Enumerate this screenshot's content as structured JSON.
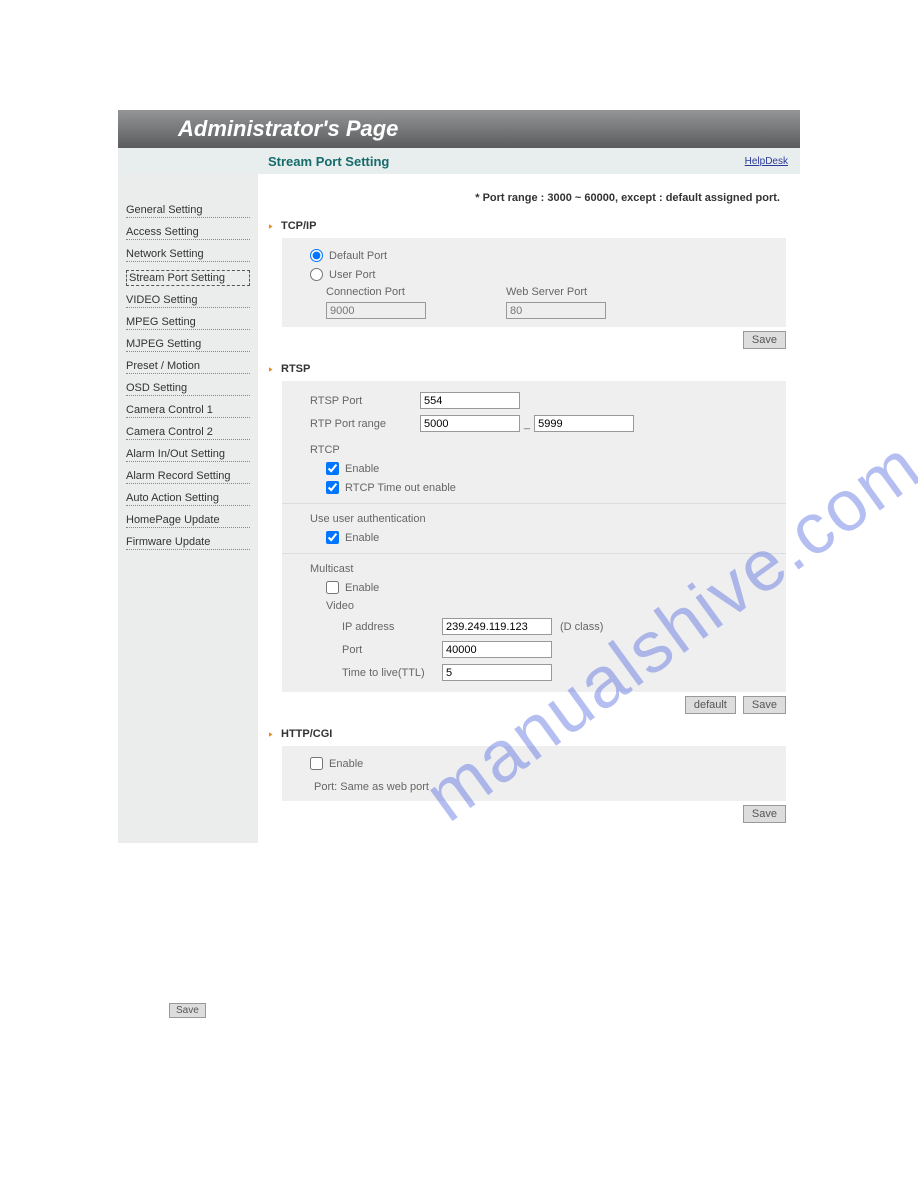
{
  "header": {
    "title": "Administrator's Page"
  },
  "subheader": {
    "title": "Stream Port Setting",
    "helpdesk": "HelpDesk"
  },
  "port_note": "* Port range : 3000 ~ 60000, except : default assigned port.",
  "sidebar": {
    "items": [
      "General Setting",
      "Access Setting",
      "Network Setting",
      "Stream Port Setting",
      "VIDEO Setting",
      "MPEG Setting",
      "MJPEG Setting",
      "Preset / Motion",
      "OSD Setting",
      "Camera Control 1",
      "Camera Control 2",
      "Alarm In/Out Setting",
      "Alarm Record Setting",
      "Auto Action Setting",
      "HomePage Update",
      "Firmware Update"
    ],
    "active_index": 3
  },
  "tcpip": {
    "title": "TCP/IP",
    "default_port_label": "Default Port",
    "user_port_label": "User Port",
    "port_mode": "default",
    "conn_port_label": "Connection Port",
    "web_port_label": "Web Server Port",
    "conn_port": "9000",
    "web_port": "80",
    "save": "Save"
  },
  "rtsp": {
    "title": "RTSP",
    "rtsp_port_label": "RTSP Port",
    "rtsp_port": "554",
    "rtp_range_label": "RTP Port range",
    "rtp_from": "5000",
    "rtp_to": "5999",
    "rtcp_label": "RTCP",
    "enable_label": "Enable",
    "rtcp_enable": true,
    "rtcp_timeout_label": "RTCP Time out enable",
    "rtcp_timeout": true,
    "auth_label": "Use user authentication",
    "auth_enable": true,
    "multicast_label": "Multicast",
    "multicast_enable": false,
    "video_label": "Video",
    "ip_label": "IP address",
    "ip": "239.249.119.123",
    "dclass": "(D class)",
    "port_label": "Port",
    "port": "40000",
    "ttl_label": "Time to live(TTL)",
    "ttl": "5",
    "default_btn": "default",
    "save": "Save"
  },
  "httpcgi": {
    "title": "HTTP/CGI",
    "enable_label": "Enable",
    "enable": false,
    "port_note": "Port: Same as web port",
    "save": "Save"
  },
  "lonely_save": "Save",
  "watermark": "manualshive.com"
}
